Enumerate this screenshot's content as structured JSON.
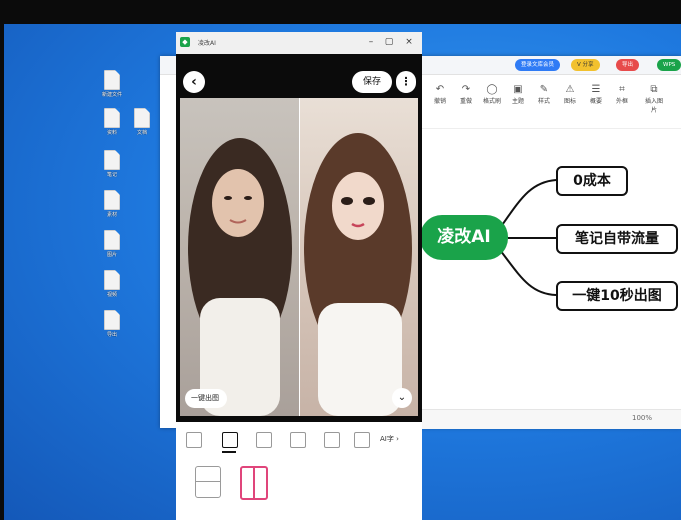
{
  "phone_window": {
    "title": "凌改AI",
    "save_label": "保存",
    "more_label": "⋮",
    "back_label": "‹",
    "photo_pill_label": "一键出图",
    "collapse_label": "⌄",
    "layout_more_label": "AI字 ›"
  },
  "mindmap": {
    "root": "凌改AI",
    "branches": [
      "0成本",
      "笔记自带流量",
      "一键10秒出图"
    ],
    "root_color": "#1aa34a"
  },
  "mm_toolbar": {
    "tools": [
      {
        "icon": "↶",
        "label": "撤销"
      },
      {
        "icon": "↷",
        "label": "重做"
      },
      {
        "icon": "◯",
        "label": "格式刷"
      },
      {
        "icon": "▣",
        "label": "主题"
      },
      {
        "icon": "✎",
        "label": "样式"
      },
      {
        "icon": "⚠",
        "label": "图标"
      },
      {
        "icon": "☰",
        "label": "概要"
      },
      {
        "icon": "⌗",
        "label": "外框"
      },
      {
        "icon": "⧉",
        "label": "插入图片"
      }
    ],
    "pills": [
      {
        "label": "登录文库会员",
        "color": "#2f7bf5"
      },
      {
        "label": "V 分享",
        "color": "#f2c12e"
      },
      {
        "label": "导出",
        "color": "#e74b4b"
      },
      {
        "label": "WPS",
        "color": "#1aa34a"
      }
    ]
  },
  "mm_status": {
    "zoom": "100%"
  },
  "desktop_icons": [
    {
      "label": "新建文件"
    },
    {
      "label": "资料"
    },
    {
      "label": "文档"
    },
    {
      "label": "笔记"
    },
    {
      "label": "素材"
    },
    {
      "label": "图片"
    },
    {
      "label": "视频"
    },
    {
      "label": "导出"
    }
  ]
}
